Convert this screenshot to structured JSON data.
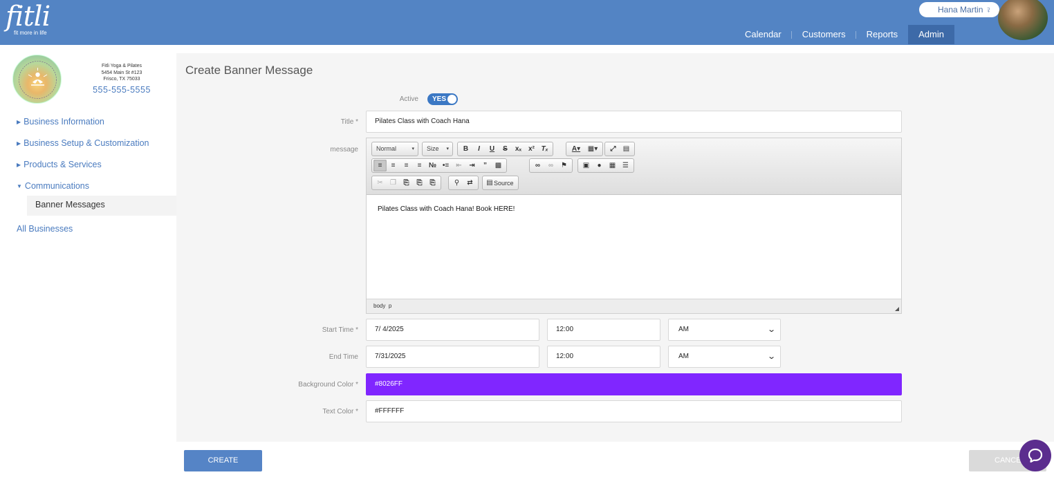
{
  "header": {
    "logo_word": "fitli",
    "logo_tagline": "fit more in life",
    "user_name": "Hana Martin",
    "nav": [
      "Calendar",
      "Customers",
      "Reports",
      "Admin"
    ],
    "active_nav": "Admin",
    "brand_color": "#5384c4"
  },
  "business": {
    "name": "Fitli Yoga & Pilates",
    "address1": "5454 Main St #123",
    "address2": "Frisco, TX 75033",
    "phone": "555-555-5555"
  },
  "sidebar": {
    "items": [
      {
        "label": "Business Information",
        "caret": "right"
      },
      {
        "label": "Business Setup & Customization",
        "caret": "right"
      },
      {
        "label": "Products & Services",
        "caret": "right"
      },
      {
        "label": "Communications",
        "caret": "down"
      }
    ],
    "sub_item": "Banner Messages",
    "all_businesses": "All Businesses"
  },
  "form": {
    "page_title": "Create Banner Message",
    "active_label": "Active",
    "active_toggle": "YES",
    "title_label": "Title *",
    "title_value": "Pilates Class with Coach Hana",
    "message_label": "message",
    "editor": {
      "format_combo": "Normal",
      "size_combo": "Size",
      "source_button": "Source",
      "content": "Pilates Class with Coach Hana! Book HERE!",
      "path_body": "body",
      "path_p": "p"
    },
    "start_label": "Start Time *",
    "start_date": "7/  4/2025",
    "start_time": "12:00",
    "start_ampm": "AM",
    "end_label": "End Time",
    "end_date": "7/31/2025",
    "end_time": "12:00",
    "end_ampm": "AM",
    "bg_color_label": "Background Color *",
    "bg_color_value": "#8026FF",
    "text_color_label": "Text Color *",
    "text_color_value": "#FFFFFF"
  },
  "actions": {
    "create": "CREATE",
    "cancel": "CANCEL"
  }
}
